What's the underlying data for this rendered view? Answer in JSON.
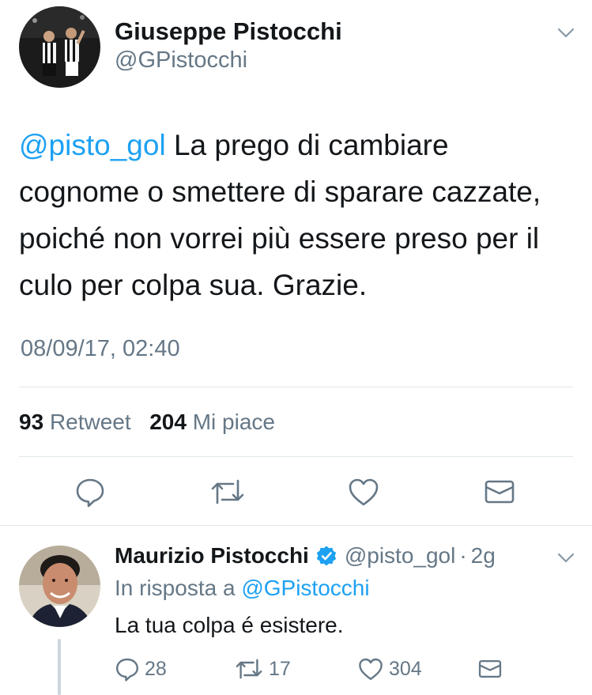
{
  "tweet": {
    "author_name": "Giuseppe Pistocchi",
    "author_handle": "@GPistocchi",
    "mention": "@pisto_gol",
    "text": " La prego di cambiare cognome o smettere di sparare cazzate, poiché non vorrei più essere preso per il culo per colpa sua. Grazie.",
    "timestamp": "08/09/17, 02:40",
    "retweet_count": "93",
    "retweet_label": "Retweet",
    "like_count": "204",
    "like_label": "Mi piace"
  },
  "reply": {
    "author_name": "Maurizio Pistocchi",
    "author_handle": "@pisto_gol",
    "separator": "·",
    "age": "2g",
    "in_reply_prefix": "In risposta a",
    "in_reply_handle": "@GPistocchi",
    "text": "La tua colpa é esistere.",
    "reply_count": "28",
    "retweet_count": "17",
    "like_count": "304"
  },
  "colors": {
    "link": "#1da1f2",
    "muted": "#657786",
    "divider": "#e1e8ed",
    "verified": "#1da1f2"
  },
  "icons": {
    "reply": "speech-bubble-icon",
    "retweet": "retweet-arrows-icon",
    "like": "heart-icon",
    "dm": "envelope-icon",
    "menu": "chevron-down-icon",
    "verified": "verified-badge-icon"
  }
}
